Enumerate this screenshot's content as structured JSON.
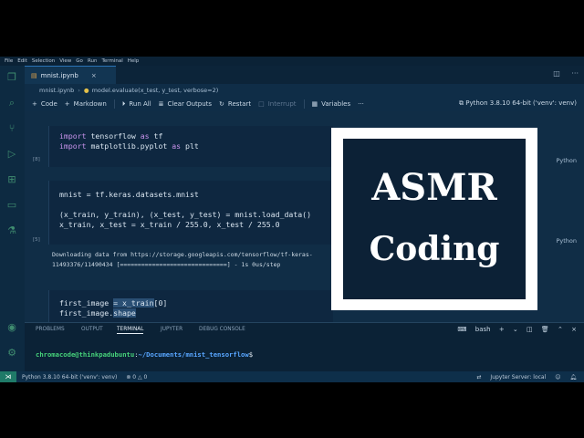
{
  "menubar": [
    "File",
    "Edit",
    "Selection",
    "View",
    "Go",
    "Run",
    "Terminal",
    "Help"
  ],
  "tab": {
    "label": "mnist.ipynb",
    "close": "×"
  },
  "breadcrumb": {
    "file": "mnist.ipynb",
    "symbol": "model.evaluate(x_test, y_test, verbose=2)"
  },
  "toolbar": {
    "code": "Code",
    "markdown": "Markdown",
    "run_all": "Run All",
    "clear_outputs": "Clear Outputs",
    "restart": "Restart",
    "interrupt": "Interrupt",
    "variables": "Variables",
    "more": "···",
    "kernel": "Python 3.8.10 64-bit ('venv': venv)"
  },
  "cells": [
    {
      "exec": "[8]",
      "lang": "Python",
      "lines": [
        "import tensorflow as tf",
        "import matplotlib.pyplot as plt"
      ]
    },
    {
      "exec": "[5]",
      "lang": "Python",
      "lines": [
        "mnist = tf.keras.datasets.mnist",
        "",
        "(x_train, y_train), (x_test, y_test) = mnist.load_data()",
        "x_train, x_test = x_train / 255.0, x_test / 255.0"
      ],
      "output": [
        "Downloading data from https://storage.googleapis.com/tensorflow/tf-keras-",
        "11493376/11490434 [==============================] - 1s 0us/step"
      ]
    },
    {
      "lines": [
        "first_image = x_train[0]",
        "first_image.shape"
      ]
    }
  ],
  "overlay": {
    "line1": "ASMR",
    "line2": "Coding"
  },
  "panel": {
    "tabs": [
      "PROBLEMS",
      "OUTPUT",
      "TERMINAL",
      "JUPYTER",
      "DEBUG CONSOLE"
    ],
    "active_tab": "TERMINAL",
    "shell": "bash",
    "prompt_user": "chromacode@thinkpadubuntu",
    "prompt_sep": ":",
    "prompt_path": "~/Documents/mnist_tensorflow",
    "prompt_end": "$"
  },
  "status": {
    "interpreter": "Python 3.8.10 64-bit ('venv': venv)",
    "errors": "0",
    "warnings": "0",
    "jupyter": "Jupyter Server: local"
  },
  "colors": {
    "editor_bg": "#102d46",
    "accent_green": "#46d27a",
    "accent_blue": "#58a6ff",
    "overlay_bg": "#0c2136"
  }
}
